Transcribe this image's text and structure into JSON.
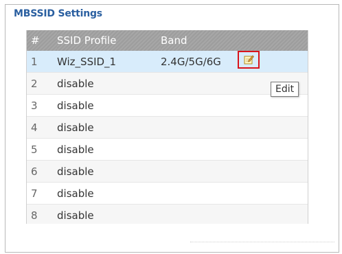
{
  "section_title": "MBSSID Settings",
  "table": {
    "headers": [
      "#",
      "SSID Profile",
      "Band"
    ],
    "rows": [
      {
        "num": "1",
        "ssid": "Wiz_SSID_1",
        "band": "2.4G/5G/6G"
      },
      {
        "num": "2",
        "ssid": "disable",
        "band": ""
      },
      {
        "num": "3",
        "ssid": "disable",
        "band": ""
      },
      {
        "num": "4",
        "ssid": "disable",
        "band": ""
      },
      {
        "num": "5",
        "ssid": "disable",
        "band": ""
      },
      {
        "num": "6",
        "ssid": "disable",
        "band": ""
      },
      {
        "num": "7",
        "ssid": "disable",
        "band": ""
      },
      {
        "num": "8",
        "ssid": "disable",
        "band": ""
      }
    ],
    "edit_icon": "edit-pencil-icon"
  },
  "tooltip": "Edit",
  "colors": {
    "title": "#2a5fa0",
    "selected_row": "#d8ecfb",
    "highlight_border": "#d9131a",
    "header_bg": "#a7a7a7"
  }
}
